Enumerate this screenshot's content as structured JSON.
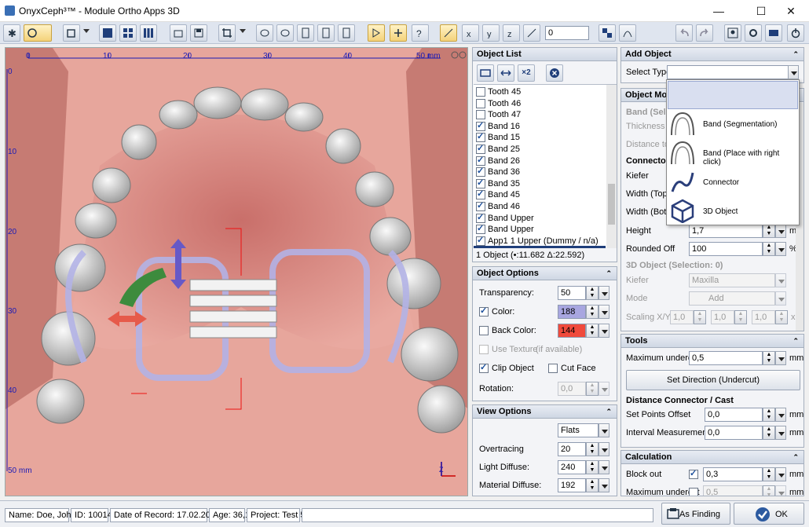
{
  "window": {
    "title": "OnyxCeph³™ - Module Ortho Apps 3D",
    "minimize": "—",
    "maximize": "☐",
    "close": "✕"
  },
  "toolbar": {
    "spin_value": "0"
  },
  "view": {
    "ruler_x": [
      "0",
      "10",
      "20",
      "30",
      "40",
      "50 mm"
    ],
    "ruler_y": [
      "0",
      "10",
      "20",
      "30",
      "40",
      "50 mm"
    ]
  },
  "object_list": {
    "title": "Object List",
    "items": [
      {
        "label": "Tooth 45",
        "checked": false
      },
      {
        "label": "Tooth 46",
        "checked": false
      },
      {
        "label": "Tooth 47",
        "checked": false
      },
      {
        "label": "Band 16",
        "checked": true
      },
      {
        "label": "Band 15",
        "checked": true
      },
      {
        "label": "Band 25",
        "checked": true
      },
      {
        "label": "Band 26",
        "checked": true
      },
      {
        "label": "Band 36",
        "checked": true
      },
      {
        "label": "Band 35",
        "checked": true
      },
      {
        "label": "Band 45",
        "checked": true
      },
      {
        "label": "Band 46",
        "checked": true
      },
      {
        "label": "Band Upper",
        "checked": true
      },
      {
        "label": "Band Upper",
        "checked": true
      },
      {
        "label": "App1 1 Upper (Dummy  / n/a)",
        "checked": true
      }
    ],
    "status": "1 Object (•:11.682 Δ:22.592)",
    "x2_label": "×2"
  },
  "object_options": {
    "title": "Object Options",
    "transparency_label": "Transparency:",
    "transparency_value": "50",
    "color_label": "Color:",
    "color_value": "188",
    "color_hex": "#a8a6e0",
    "back_color_label": "Back Color:",
    "back_color_value": "144",
    "back_color_hex": "#f04a3c",
    "use_texture_label": "Use Texture",
    "use_texture_note": "(if available)",
    "clip_object_label": "Clip Object",
    "cut_face_label": "Cut Face",
    "rotation_label": "Rotation:",
    "rotation_value": "0,0"
  },
  "view_options": {
    "title": "View Options",
    "mode_value": "Flats",
    "overtracing_label": "Overtracing",
    "overtracing_value": "20",
    "light_label": "Light Diffuse:",
    "light_value": "240",
    "material_label": "Material Diffuse:",
    "material_value": "192"
  },
  "add_object": {
    "title": "Add Object",
    "select_type_label": "Select Type",
    "select_type_value": "",
    "popup_items": [
      "Band (Segmentation)",
      "Band (Place with right click)",
      "Connector",
      "3D Object"
    ]
  },
  "object_model": {
    "title": "Object Mod",
    "band_sel": "Band (Sele",
    "thickness_label": "Thickness",
    "distance_label": "Distance to c",
    "connector_label": "Connector",
    "kiefer_label": "Kiefer",
    "width_top_label": "Width (Top)",
    "width_bottom_label": "Width (Botto",
    "height_label": "Height",
    "height_value": "1,7",
    "rounded_label": "Rounded Off",
    "rounded_value": "100",
    "rounded_unit": "%",
    "obj3d_label": "3D Object (Selection: 0)",
    "kiefer2_label": "Kiefer",
    "kiefer2_value": "Maxilla",
    "mode_label": "Mode",
    "mode_value": "Add",
    "scaling_label": "Scaling X/Y/Z",
    "scaling_x": "1,0",
    "scaling_y": "1,0",
    "scaling_z": "1,0",
    "scaling_unit": "x",
    "mm": "mm"
  },
  "tools": {
    "title": "Tools",
    "max_undercut_label": "Maximum undercut",
    "max_undercut_value": "0,5",
    "set_direction_label": "Set Direction (Undercut)",
    "distance_title": "Distance Connector / Cast",
    "set_points_label": "Set Points Offset",
    "set_points_value": "0,0",
    "interval_label": "Interval Measurements",
    "interval_value": "0,0",
    "mm": "mm"
  },
  "calculation": {
    "title": "Calculation",
    "block_out_label": "Block out",
    "block_out_value": "0,3",
    "max_undercut_label": "Maximum undercut",
    "max_undercut_value": "0,5",
    "mm": "mm"
  },
  "status": {
    "name": "Name: Doe, John",
    "id": "ID: 10014",
    "date": "Date of Record: 17.02.2016",
    "age": "Age: 36,1",
    "project": "Project: Test 5",
    "as_finding": "As Finding",
    "ok": "OK"
  }
}
